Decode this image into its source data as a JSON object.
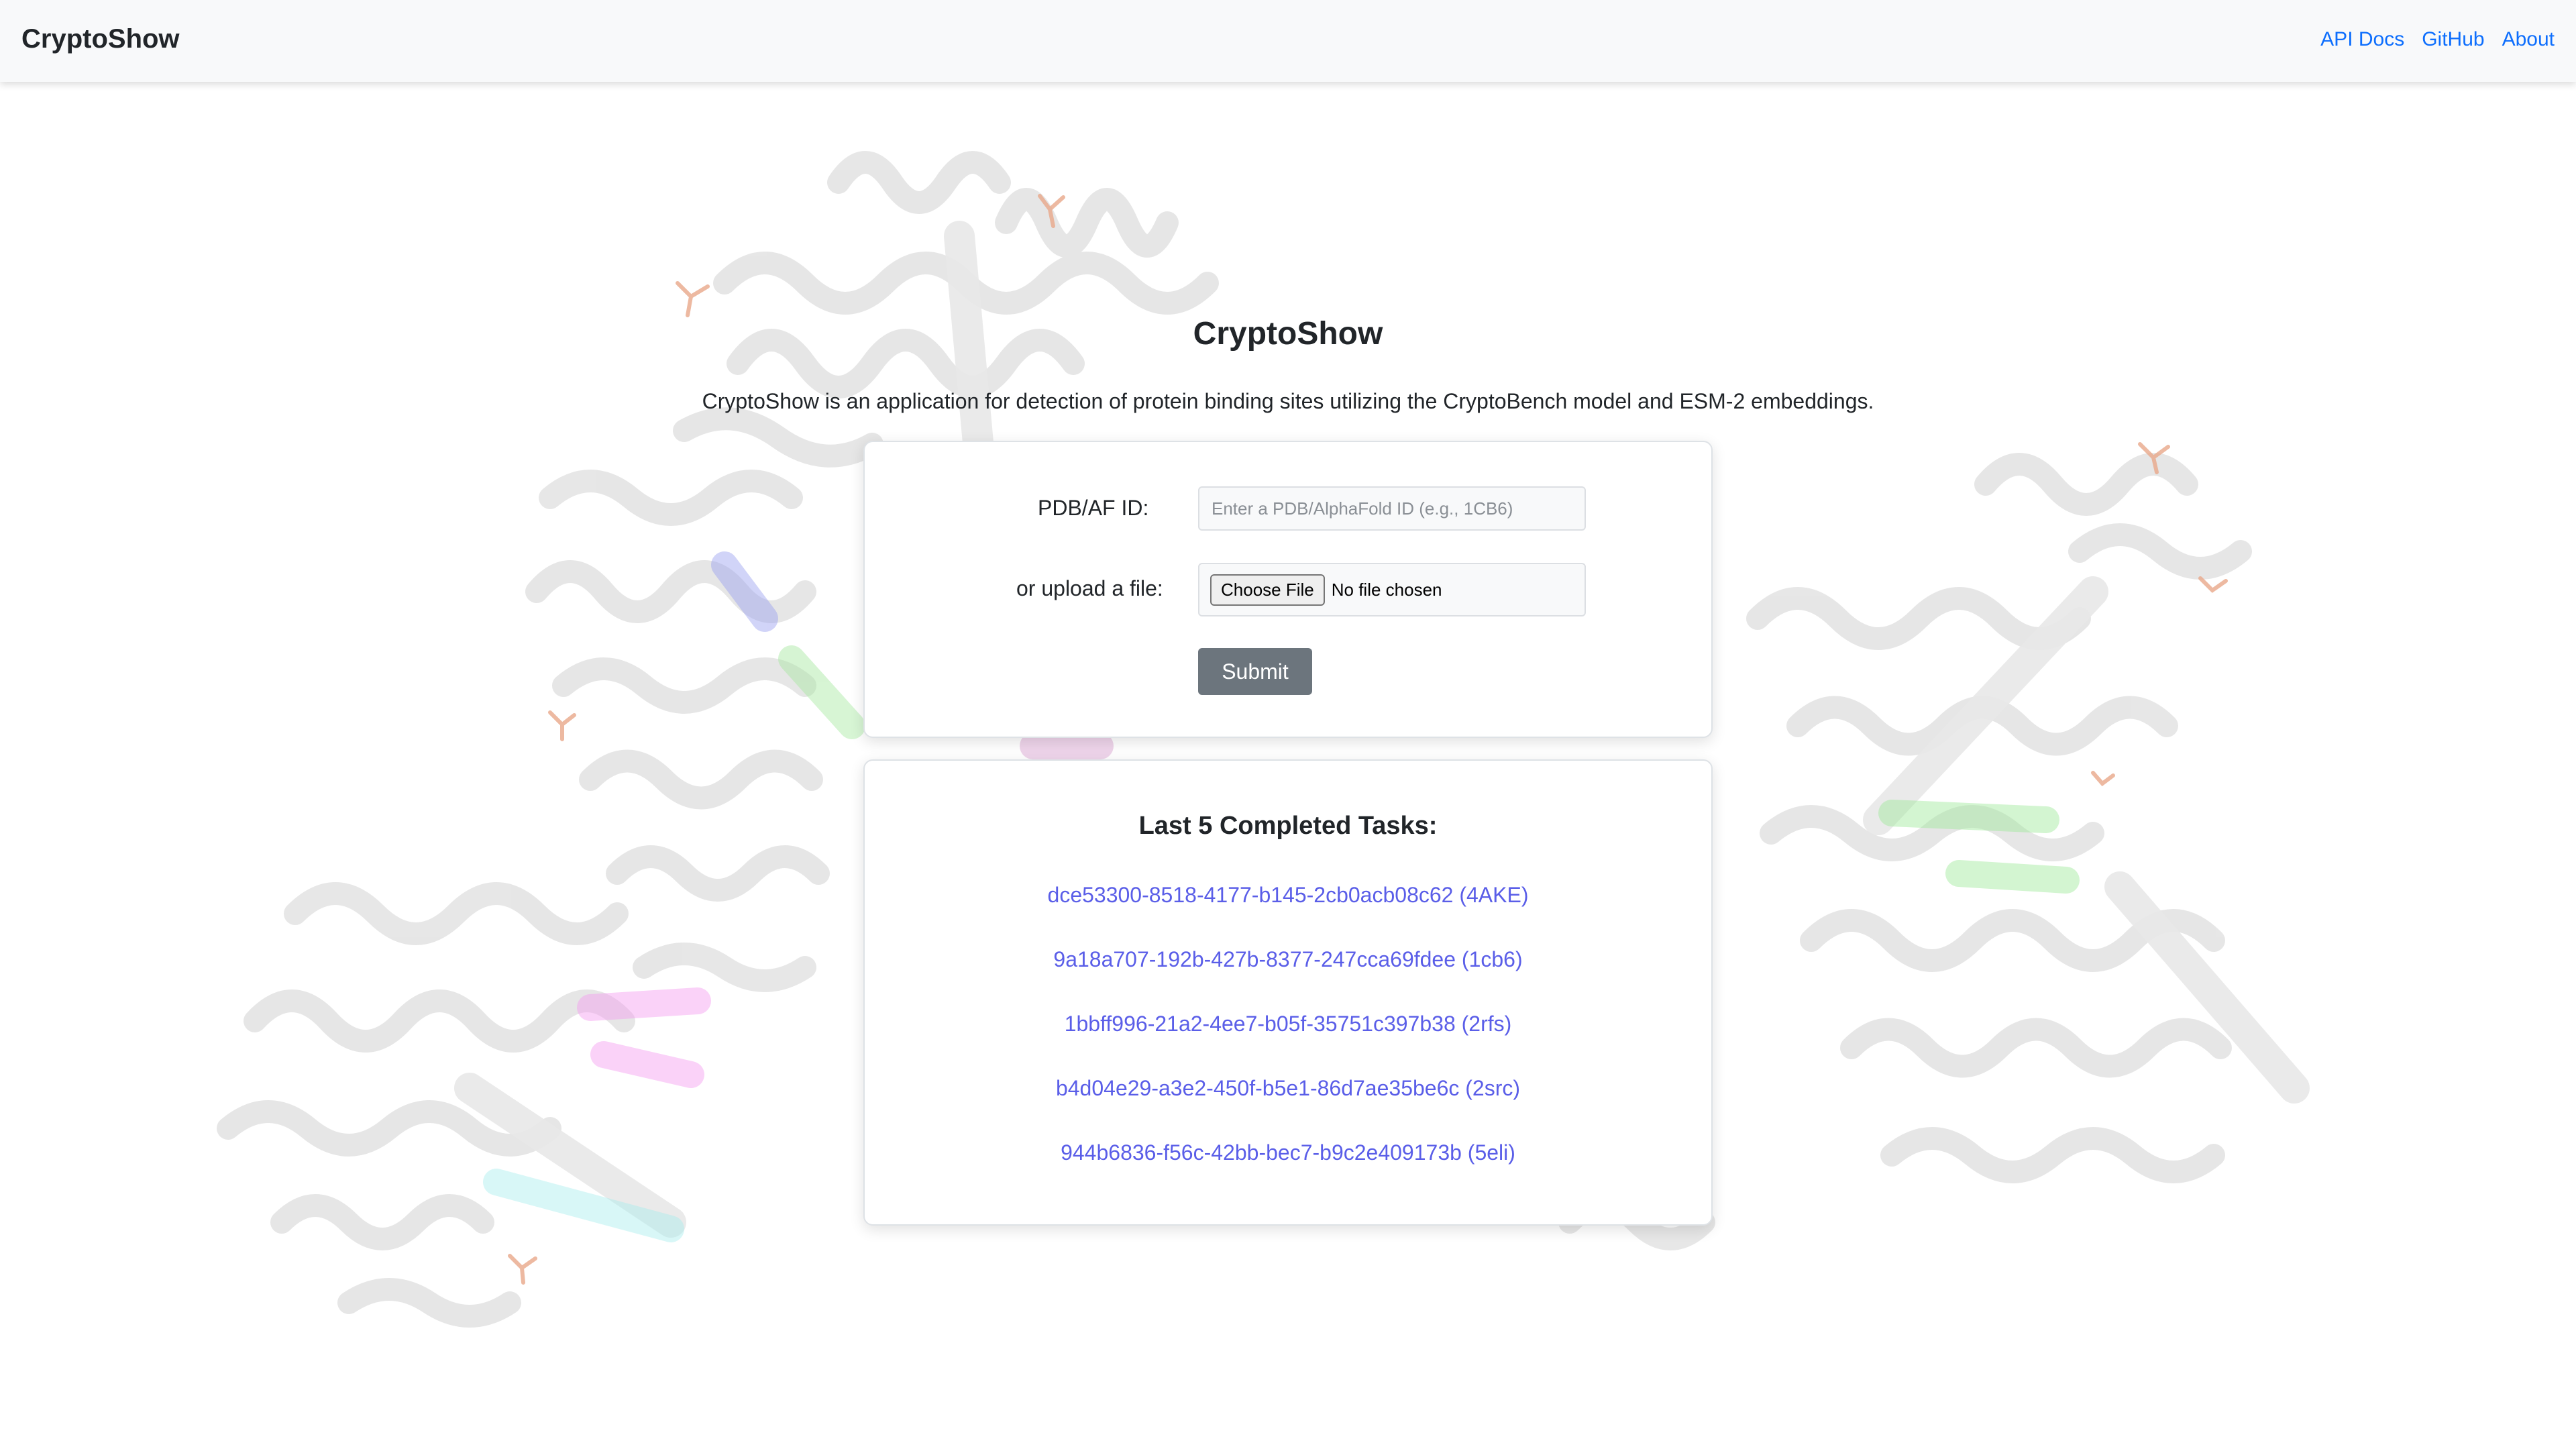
{
  "navbar": {
    "brand": "CryptoShow",
    "links": [
      "API Docs",
      "GitHub",
      "About"
    ]
  },
  "main": {
    "title": "CryptoShow",
    "subtitle": "CryptoShow is an application for detection of protein binding sites utilizing the CryptoBench model and ESM-2 embeddings."
  },
  "form": {
    "pdb_label": "PDB/AF ID:",
    "pdb_placeholder": "Enter a PDB/AlphaFold ID (e.g., 1CB6)",
    "pdb_value": "",
    "upload_label": "or upload a file:",
    "choose_file_label": "Choose File",
    "file_status": "No file chosen",
    "submit_label": "Submit"
  },
  "tasks": {
    "heading": "Last 5 Completed Tasks:",
    "items": [
      "dce53300-8518-4177-b145-2cb0acb08c62 (4AKE)",
      "9a18a707-192b-427b-8377-247cca69fdee (1cb6)",
      "1bbff996-21a2-4ee7-b05f-35751c397b38 (2rfs)",
      "b4d04e29-a3e2-450f-b5e1-86d7ae35be6c (2src)",
      "944b6836-f56c-42bb-bec7-b9c2e409173b (5eli)"
    ]
  },
  "colors": {
    "navbar_bg": "#f8f9fa",
    "link": "#0d6efd",
    "task_link": "#5a5ee8",
    "submit_bg": "#6c757d"
  }
}
